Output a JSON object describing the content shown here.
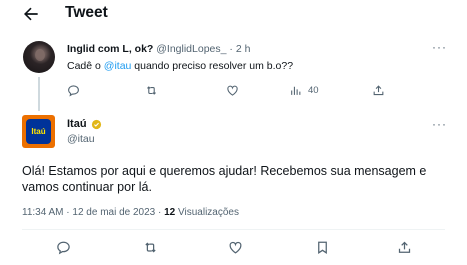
{
  "header": {
    "title": "Tweet"
  },
  "reply_tweet": {
    "display_name": "Inglid com L, ok?",
    "handle": "@InglidLopes_",
    "separator": "·",
    "time": "2 h",
    "text_before": "Cadê o ",
    "mention": "@itau",
    "text_after": " quando preciso resolver um b.o??",
    "more": "···",
    "views_count": "40"
  },
  "main_tweet": {
    "display_name": "Itaú",
    "handle": "@itau",
    "avatar_text": "Itaú",
    "more": "···",
    "text": "Olá! Estamos por aqui e queremos ajudar! Recebemos sua mensagem e vamos continuar por lá.",
    "timestamp": "11:34 AM · 12 de mai de 2023 · ",
    "views_count": "12",
    "views_label": " Visualizações"
  },
  "colors": {
    "accent": "#1d9bf0",
    "secondary_text": "#536471",
    "brand_orange": "#ec7000",
    "brand_blue": "#003399",
    "verified_gold": "#e2b719"
  },
  "icons": [
    "back-arrow-icon",
    "reply-icon",
    "retweet-icon",
    "like-icon",
    "views-icon",
    "share-icon",
    "verified-badge-icon",
    "more-icon"
  ]
}
